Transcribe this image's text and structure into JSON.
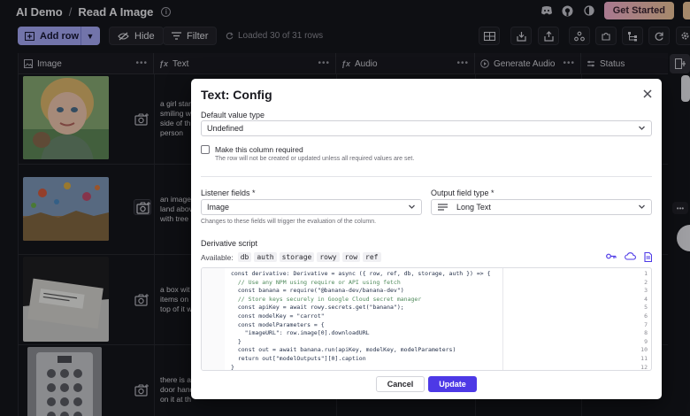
{
  "breadcrumb": {
    "project": "AI Demo",
    "separator": "/",
    "table": "Read A Image"
  },
  "header_right": {
    "get_started": "Get Started"
  },
  "toolbar": {
    "add_row": "Add row",
    "hide": "Hide",
    "filter": "Filter",
    "loaded_text": "Loaded 30 of 31 rows"
  },
  "columns": [
    {
      "icon": "image-icon",
      "label": "Image"
    },
    {
      "icon": "fx",
      "label": "Text"
    },
    {
      "icon": "fx",
      "label": "Audio"
    },
    {
      "icon": "action-icon",
      "label": "Generate Audio"
    },
    {
      "icon": "status-icon",
      "label": "Status"
    }
  ],
  "rows": [
    {
      "text_lines": [
        "a girl star",
        "smiling w",
        "side of th",
        "person"
      ]
    },
    {
      "text_lines": [
        "an image",
        "land abov",
        "with tree"
      ]
    },
    {
      "text_lines": [
        "a box wit",
        "items on",
        "top of it w"
      ]
    },
    {
      "text_lines": [
        "there is a",
        "door hand",
        "on it at th"
      ]
    }
  ],
  "dialog": {
    "title": "Text: Config",
    "default_value_label": "Default value type",
    "default_value": "Undefined",
    "required_label": "Make this column required",
    "required_helper": "The row will not be created or updated unless all required values are set.",
    "listener_label": "Listener fields *",
    "listener_value": "Image",
    "listener_helper": "Changes to these fields will trigger the evaluation of the column.",
    "output_label": "Output field type *",
    "output_value": "Long Text",
    "derivative_label": "Derivative script",
    "available_label": "Available:",
    "available_chips": [
      "db",
      "auth",
      "storage",
      "rowy",
      "row",
      "ref"
    ],
    "code_lines": [
      {
        "n": "1",
        "t": "const derivative: Derivative = async ({ row, ref, db, storage, auth }) => {",
        "k": "code"
      },
      {
        "n": "2",
        "t": "  // Use any NPM using require or API using fetch",
        "k": "cmt"
      },
      {
        "n": "3",
        "t": "  const banana = require(\"@banana-dev/banana-dev\")",
        "k": "code"
      },
      {
        "n": "4",
        "t": "  // Store keys securely in Google Cloud secret manager",
        "k": "cmt"
      },
      {
        "n": "5",
        "t": "  const apiKey = await rowy.secrets.get(\"banana\");",
        "k": "code"
      },
      {
        "n": "6",
        "t": "  const modelKey = \"carrot\"",
        "k": "code"
      },
      {
        "n": "7",
        "t": "  const modelParameters = {",
        "k": "code"
      },
      {
        "n": "8",
        "t": "    \"imageURL\": row.image[0].downloadURL",
        "k": "code"
      },
      {
        "n": "9",
        "t": "  }",
        "k": "code"
      },
      {
        "n": "10",
        "t": "  const out = await banana.run(apiKey, modelKey, modelParameters)",
        "k": "code"
      },
      {
        "n": "11",
        "t": "  return out[\"modelOutputs\"][0].caption",
        "k": "code"
      },
      {
        "n": "12",
        "t": "}",
        "k": "code"
      }
    ],
    "cancel": "Cancel",
    "update": "Update"
  }
}
